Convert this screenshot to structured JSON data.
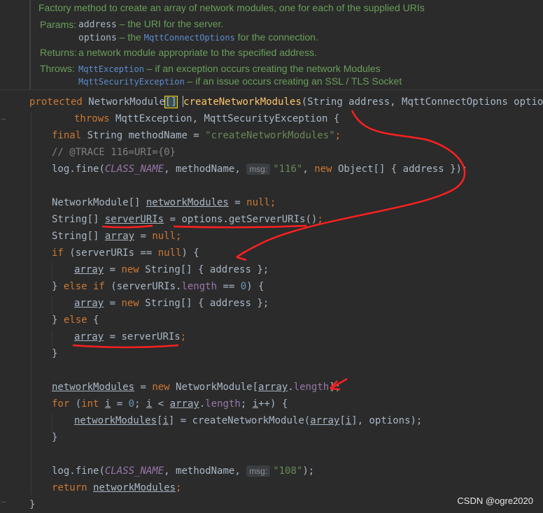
{
  "javadoc": {
    "summary": "Factory method to create an array of network modules, one for each of the supplied URIs",
    "params_label": "Params:",
    "params": [
      {
        "name": "address",
        "text": " – the URI for the server."
      },
      {
        "name": "options",
        "text_before": " – the ",
        "link": "MqttConnectOptions",
        "text_after": " for the connection."
      }
    ],
    "returns_label": "Returns:",
    "returns_text": "a network module appropriate to the specified address.",
    "throws_label": "Throws:",
    "throws": [
      {
        "link": "MqttException",
        "text": " – if an exception occurs creating the network Modules"
      },
      {
        "link": "MqttSecurityException",
        "text": " – if an issue occurs creating an SSL / TLS Socket"
      }
    ]
  },
  "code": {
    "l1": {
      "kw": "protected",
      "type": "NetworkModule",
      "br": "[]",
      "name": "createNetworkModules",
      "params": "(String address, MqttConnectOptions options)"
    },
    "l2": {
      "kw": "throws",
      "rest": " MqttException, MqttSecurityException {"
    },
    "l3": {
      "kw": "final",
      "mid": " String methodName = ",
      "str": "\"createNetworkModules\"",
      "end": ";"
    },
    "l4": {
      "comment": "// @TRACE 116=URI={0}"
    },
    "l5": {
      "obj": "log",
      "call": ".fine(",
      "const": "CLASS_NAME",
      "mid": ", methodName, ",
      "hint": "msg:",
      "str": "\"116\"",
      "sep": ", ",
      "kw": "new",
      "rest": " Object[] { address });"
    },
    "l6": {
      "pre": "NetworkModule[] ",
      "var": "networkModules",
      "eq": " = ",
      "kw": "null",
      "end": ";"
    },
    "l7": {
      "pre": "String[] ",
      "var": "serverURIs",
      "eq": " = ",
      "call": "options.getServerURIs()",
      "end": ";"
    },
    "l8": {
      "pre": "String[] ",
      "var": "array",
      "eq": " = ",
      "kw": "null",
      "end": ";"
    },
    "l9": {
      "kw": "if",
      "mid": " (serverURIs == ",
      "kw2": "null",
      "end": ") {"
    },
    "l10": {
      "var": "array",
      "eq": " = ",
      "kw": "new",
      "rest": " String[] { address };"
    },
    "l11": {
      "pre": "} ",
      "kw": "else if",
      "mid": " (serverURIs.",
      "fld": "length",
      "op": " == ",
      "num": "0",
      "end": ") {"
    },
    "l12": {
      "var": "array",
      "eq": " = ",
      "kw": "new",
      "rest": " String[] { address };"
    },
    "l13": {
      "pre": "} ",
      "kw": "else",
      "end": " {"
    },
    "l14": {
      "var": "array",
      "rest": " = serverURIs",
      "end": ";"
    },
    "l15": {
      "text": "}"
    },
    "l16": {
      "var": "networkModules",
      "eq": " = ",
      "kw": "new",
      "mid": " NetworkModule[",
      "var2": "array",
      "dot": ".",
      "fld": "length",
      "end": "];"
    },
    "l17": {
      "kw": "for",
      "p1": " (",
      "kw2": "int",
      "p2": " ",
      "i1": "i",
      "p3": " = ",
      "num": "0",
      "p4": "; ",
      "i2": "i",
      "p5": " < ",
      "arr": "array",
      "p6": ".",
      "fld": "length",
      "p7": "; ",
      "i3": "i",
      "p8": "++) {"
    },
    "l18": {
      "var": "networkModules",
      "p1": "[",
      "i": "i",
      "p2": "] = createNetworkModule(",
      "arr": "array",
      "p3": "[",
      "i2": "i",
      "p4": "], options);"
    },
    "l19": {
      "text": "}"
    },
    "l20": {
      "obj": "log",
      "call": ".fine(",
      "const": "CLASS_NAME",
      "mid": ", methodName, ",
      "hint": "msg:",
      "str": "\"108\"",
      "end": ");"
    },
    "l21": {
      "kw": "return",
      "sp": " ",
      "var": "networkModules",
      "end": ";"
    },
    "l22": {
      "text": "}"
    }
  },
  "watermark": "CSDN @ogre2020",
  "colors": {
    "background": "#2b2b2b",
    "keyword": "#cc7832",
    "string": "#6a8759",
    "annotation": "#ff2020"
  }
}
